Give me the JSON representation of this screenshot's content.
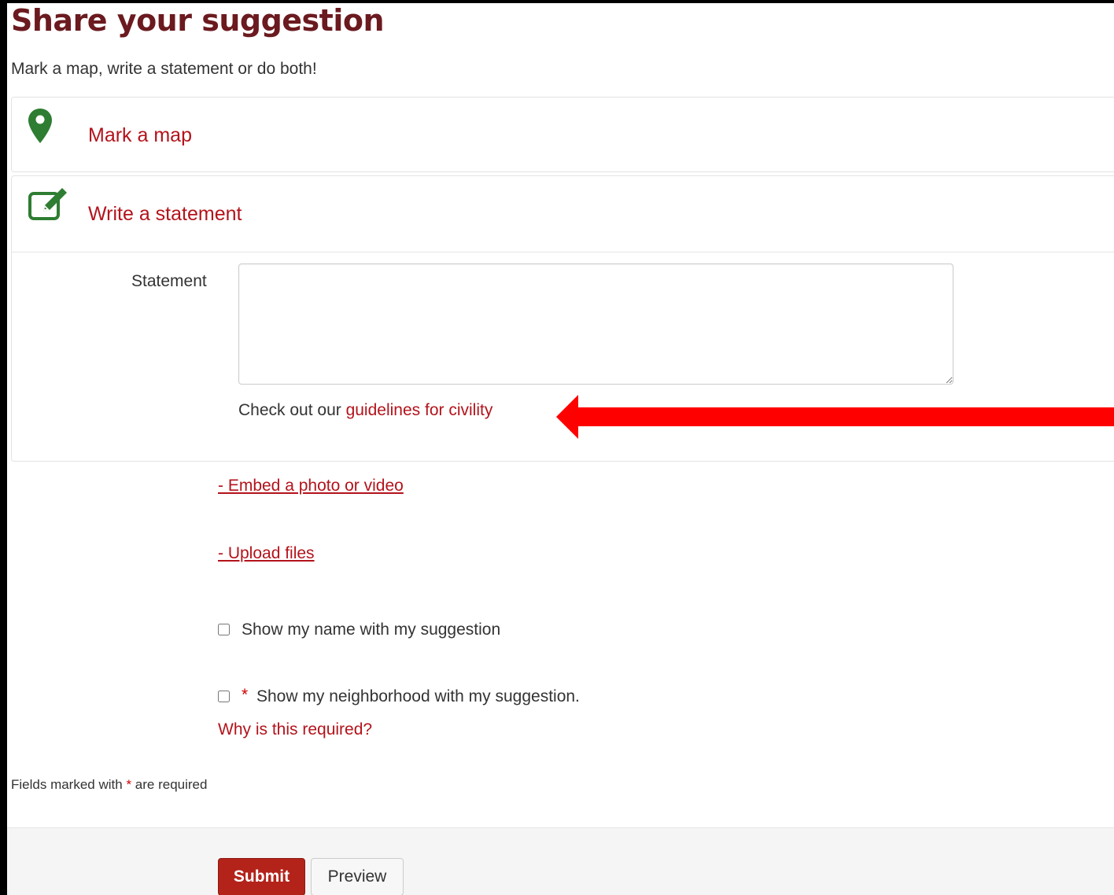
{
  "page": {
    "title": "Share your suggestion",
    "subtitle": "Mark a map, write a statement or do both!"
  },
  "sections": {
    "map": {
      "label": "Mark a map",
      "icon": "map-marker-icon"
    },
    "statement": {
      "label": "Write a statement",
      "icon": "edit-icon",
      "field_label": "Statement",
      "field_value": "",
      "civility_prefix": "Check out our ",
      "civility_link": "guidelines for civility"
    }
  },
  "links": {
    "embed": "- Embed a photo or video",
    "upload": "- Upload files"
  },
  "checkboxes": {
    "show_name": {
      "label": "Show my name with my suggestion",
      "checked": false
    },
    "show_neighborhood": {
      "label": "Show my neighborhood with my suggestion.",
      "required_mark": "*",
      "checked": false
    }
  },
  "why_required": "Why is this required?",
  "required_note": {
    "prefix": "Fields marked with ",
    "star": "*",
    "suffix": " are required"
  },
  "buttons": {
    "submit": "Submit",
    "preview": "Preview"
  },
  "colors": {
    "title": "#6b1a1f",
    "link": "#b3131b",
    "icon_green": "#2e7d32",
    "submit_bg": "#b3231a",
    "annotation_arrow": "#ff0000"
  }
}
